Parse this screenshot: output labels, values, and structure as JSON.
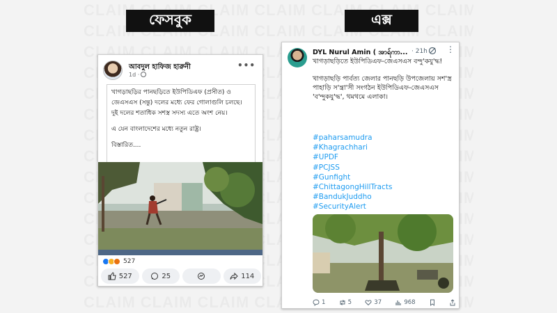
{
  "watermark": "CLAIM CLAIM CLAIM CLAIM CLAIM CLAIM CLAIM",
  "headings": {
    "facebook": "ফেসবুক",
    "x": "এক্স"
  },
  "facebook": {
    "author": "আবদুল হাফিজ হারুনী",
    "time": "1d ·",
    "more": "•••",
    "paragraphs": [
      "খাগড়াছড়ির পানছড়িতে ইউপিডিএফ (প্রসীত) ও জেএসএস (সন্তু) দলের মধ্যে ফের গোলাগুলি চলছে।",
      "দুই দলের শতাধিক সশস্ত্র সদস্য এতে অংশ নেয়।",
      "এ যেন বাংলাদেশের মধ্যে নতুন রাষ্ট্র।",
      "বিস্তারিত...."
    ],
    "reactions_count": "527",
    "actions": {
      "like": "527",
      "comment": "25",
      "messenger": "",
      "share": "114"
    },
    "colors": {
      "like": "#1877f2",
      "haha": "#f7b125",
      "wow": "#e9710f"
    }
  },
  "x": {
    "author": "DYL Nurul Amin ( အာရ်ကာ...",
    "time": "· 21h",
    "more": "⋮",
    "title": "খাগড়াছড়িতে ইউপিডিএফ-জেএসএস বন্দু'কযু'দ্ধ!",
    "body": "খাগড়াছড়ি পার্বত্য জেলার পানছড়ি উপজেলায় সশ'স্ত্র পাহাড়ি স'ন্ত্রা'সী সংগঠন ইউপিডিএফ-জেএসএস 'ব'ন্দুকযু'দ্ধ', থমথমে এলাকা।",
    "hashtags": [
      "#paharsamudra",
      "#Khagrachhari",
      "#UPDF",
      "#PCJSS",
      "#Gunfight",
      "#ChittagongHillTracts",
      "#BandukJuddho",
      "#SecurityAlert"
    ],
    "actions": {
      "reply": "1",
      "repost": "5",
      "like": "37",
      "views": "968"
    },
    "link_color": "#1d9bf0"
  }
}
